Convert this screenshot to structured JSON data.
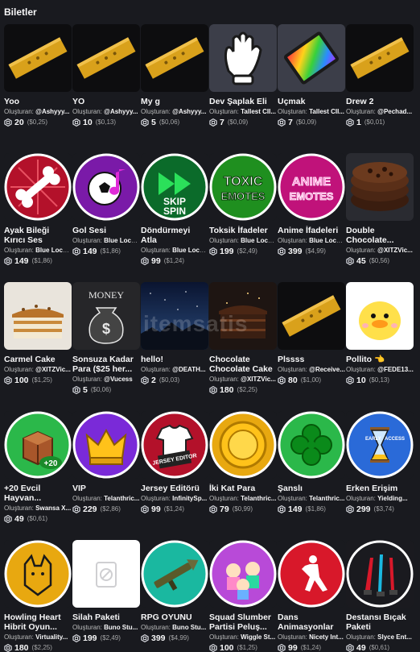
{
  "section_title": "Biletler",
  "creator_prefix": "Oluşturan:",
  "watermark": "itemsatis",
  "items": [
    {
      "name": "Yoo",
      "creator": "@Ashyyy...",
      "robux": "20",
      "usd": "($0,25)",
      "icon": "golden-ticket-icon"
    },
    {
      "name": "YO",
      "creator": "@Ashyyy...",
      "robux": "10",
      "usd": "($0,13)",
      "icon": "golden-ticket-icon"
    },
    {
      "name": "My g",
      "creator": "@Ashyyy...",
      "robux": "5",
      "usd": "($0,06)",
      "icon": "golden-ticket-icon"
    },
    {
      "name": "Dev Şaplak Eli",
      "creator": "Tallest CII...",
      "robux": "7",
      "usd": "($0,09)",
      "icon": "white-glove-icon"
    },
    {
      "name": "Uçmak",
      "creator": "Tallest CII...",
      "robux": "7",
      "usd": "($0,09)",
      "icon": "flying-carpet-icon"
    },
    {
      "name": "Drew 2",
      "creator": "@Pechad...",
      "robux": "1",
      "usd": "($0,01)",
      "icon": "golden-ticket-icon"
    },
    {
      "name": "Ayak Bileği Kırıcı Ses",
      "creator": "Blue Lock...",
      "robux": "149",
      "usd": "($1,86)",
      "icon": "bone-icon"
    },
    {
      "name": "Gol Sesi",
      "creator": "Blue Lock...",
      "robux": "149",
      "usd": "($1,86)",
      "icon": "soccer-ball-icon"
    },
    {
      "name": "Döndürmeyi Atla",
      "creator": "Blue Lock...",
      "robux": "99",
      "usd": "($1,24)",
      "icon": "skip-spin-icon"
    },
    {
      "name": "Toksik İfadeler",
      "creator": "Blue Lock...",
      "robux": "199",
      "usd": "($2,49)",
      "icon": "toxic-emotes-icon"
    },
    {
      "name": "Anime İfadeleri",
      "creator": "Blue Lock...",
      "robux": "399",
      "usd": "($4,99)",
      "icon": "anime-emotes-icon"
    },
    {
      "name": "Double Chocolate...",
      "creator": "@XITZVic...",
      "robux": "45",
      "usd": "($0,56)",
      "icon": "cookie-icon"
    },
    {
      "name": "Carmel Cake",
      "creator": "@XITZVic...",
      "robux": "100",
      "usd": "($1,25)",
      "icon": "caramel-cake-icon"
    },
    {
      "name": "Sonsuza Kadar Para ($25 her...",
      "creator": "@Vucess",
      "robux": "5",
      "usd": "($0,06)",
      "icon": "money-bag-icon"
    },
    {
      "name": "hello!",
      "creator": "@DEATH...",
      "robux": "2",
      "usd": "($0,03)",
      "icon": "night-sky-icon"
    },
    {
      "name": "Chocolate Chocolate Cake",
      "creator": "@XITZVic...",
      "robux": "180",
      "usd": "($2,25)",
      "icon": "chocolate-cake-icon"
    },
    {
      "name": "Plssss",
      "creator": "@Receive...",
      "robux": "80",
      "usd": "($1,00)",
      "icon": "golden-ticket-icon"
    },
    {
      "name": "Pollito 👈",
      "creator": "@FEDE13...",
      "robux": "10",
      "usd": "($0,13)",
      "icon": "duck-icon"
    },
    {
      "name": "+20 Evcil Hayvan...",
      "creator": "Swansa X...",
      "robux": "49",
      "usd": "($0,61)",
      "icon": "pet-crate-icon"
    },
    {
      "name": "VIP",
      "creator": "Telanthric...",
      "robux": "229",
      "usd": "($2,86)",
      "icon": "vip-crown-icon"
    },
    {
      "name": "Jersey Editörü",
      "creator": "InfinitySp...",
      "robux": "99",
      "usd": "($1,24)",
      "icon": "jersey-editor-icon"
    },
    {
      "name": "İki Kat Para",
      "creator": "Telanthric...",
      "robux": "79",
      "usd": "($0,99)",
      "icon": "gold-coin-icon"
    },
    {
      "name": "Şanslı",
      "creator": "Telanthric...",
      "robux": "149",
      "usd": "($1,86)",
      "icon": "clover-icon"
    },
    {
      "name": "Erken Erişim",
      "creator": "Yielding...",
      "robux": "299",
      "usd": "($3,74)",
      "icon": "hourglass-icon"
    },
    {
      "name": "Howling Heart Hibrit Oyun...",
      "creator": "Virtuality...",
      "robux": "180",
      "usd": "($2,25)",
      "icon": "wolf-icon"
    },
    {
      "name": "Silah Paketi",
      "creator": "Buno Stu...",
      "robux": "199",
      "usd": "($2,49)",
      "icon": "placeholder-image-icon"
    },
    {
      "name": "RPG OYUNU",
      "creator": "Buno Stu...",
      "robux": "399",
      "usd": "($4,99)",
      "icon": "rpg-launcher-icon"
    },
    {
      "name": "Squad Slumber Partisi Peluş...",
      "creator": "Wiggle St...",
      "robux": "100",
      "usd": "($1,25)",
      "icon": "plush-squad-icon"
    },
    {
      "name": "Dans Animasyonlar",
      "creator": "Nicety Int...",
      "robux": "99",
      "usd": "($1,24)",
      "icon": "dance-icon"
    },
    {
      "name": "Destansı Bıçak Paketi",
      "creator": "Slyce Ent...",
      "robux": "49",
      "usd": "($0,61)",
      "icon": "knives-icon"
    }
  ]
}
